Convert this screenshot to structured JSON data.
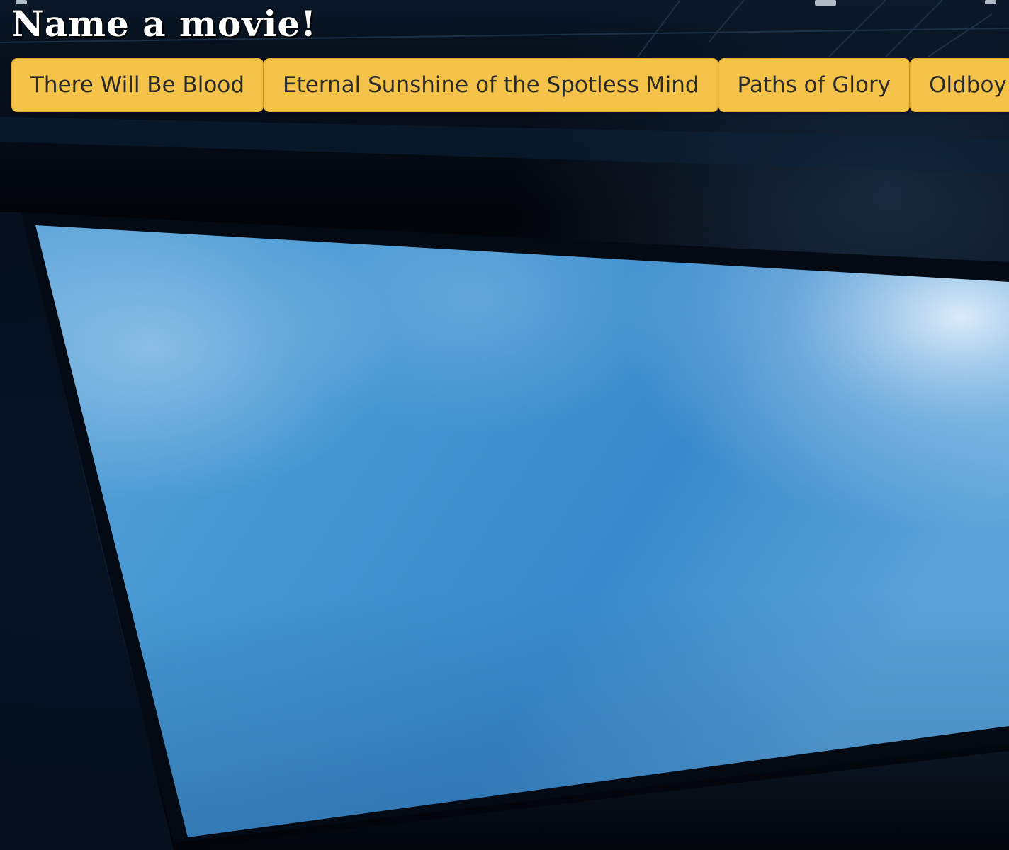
{
  "page": {
    "title": "Name a movie!"
  },
  "movies": [
    {
      "label": "There Will Be Blood"
    },
    {
      "label": "Eternal Sunshine of the Spotless Mind"
    },
    {
      "label": "Paths of Glory"
    },
    {
      "label": "Oldboy"
    }
  ],
  "colors": {
    "button_bg": "#f5c34a",
    "button_text": "#2a2a2a",
    "title_text": "#ffffff",
    "background": "#03060c",
    "screen_accent": "#3e8fcc"
  },
  "background_image": {
    "subject": "cinema-screen"
  }
}
